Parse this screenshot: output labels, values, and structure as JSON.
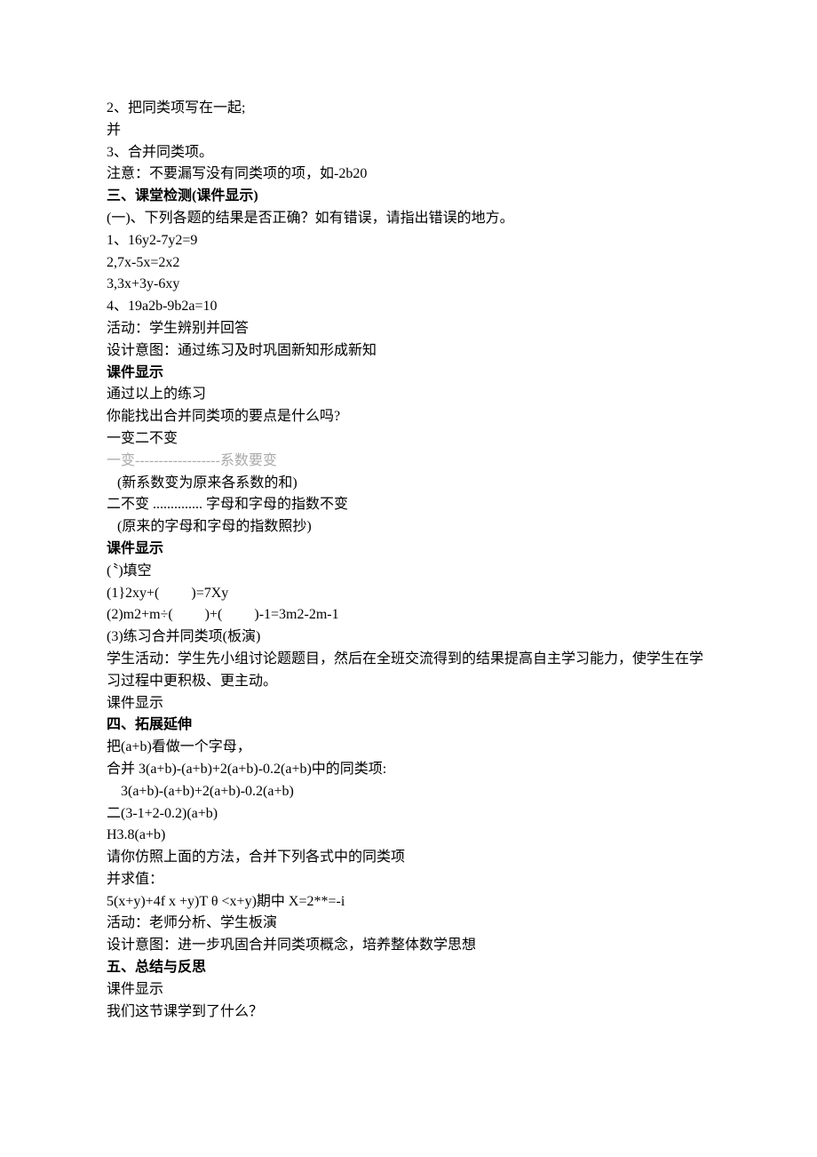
{
  "lines": [
    {
      "t": "2、把同类项写在一起;"
    },
    {
      "t": "并"
    },
    {
      "t": "3、合并同类项。"
    },
    {
      "t": "注意：不要漏写没有同类项的项，如-2b20"
    },
    {
      "t": "三、课堂检测(课件显示)",
      "bold": true
    },
    {
      "t": "(一)、下列各题的结果是否正确？如有错误，请指出错误的地方。"
    },
    {
      "t": "1、16y2-7y2=9"
    },
    {
      "t": "2,7x-5x=2x2"
    },
    {
      "t": "3,3x+3y-6xy"
    },
    {
      "t": "4、19a2b-9b2a=10"
    },
    {
      "t": "活动：学生辨别并回答"
    },
    {
      "t": "设计意图：通过练习及时巩固新知形成新知"
    },
    {
      "t": "课件显示",
      "bold": true
    },
    {
      "t": "通过以上的练习"
    },
    {
      "t": "你能找出合并同类项的要点是什么吗?"
    },
    {
      "t": "一变二不变"
    },
    {
      "t": "一变------------------系数要变",
      "faint": true
    },
    {
      "t": "   (新系数变为原来各系数的和)"
    },
    {
      "t": "二不变 .............. 字母和字母的指数不变"
    },
    {
      "t": "   (原来的字母和字母的指数照抄)"
    },
    {
      "t": "课件显示",
      "bold": true
    },
    {
      "t": "(〝)填空"
    },
    {
      "t": "(1}2xy+(         )=7Xy"
    },
    {
      "t": "(2)m2+m÷(         )+(         )-1=3m2-2m-1"
    },
    {
      "t": "(3)练习合并同类项(板演)"
    },
    {
      "t": "学生活动：学生先小组讨论题题目，然后在全班交流得到的结果提高自主学习能力，使学生在学习过程中更积极、更主动。"
    },
    {
      "t": "课件显示"
    },
    {
      "t": "四、拓展延伸",
      "bold": true
    },
    {
      "t": "把(a+b)看做一个字母，"
    },
    {
      "t": "合并 3(a+b)-(a+b)+2(a+b)-0.2(a+b)中的同类项:"
    },
    {
      "t": "    3(a+b)-(a+b)+2(a+b)-0.2(a+b)"
    },
    {
      "t": "二(3-1+2-0.2)(a+b)"
    },
    {
      "t": "H3.8(a+b)"
    },
    {
      "t": "请你仿照上面的方法，合并下列各式中的同类项"
    },
    {
      "t": "并求值："
    },
    {
      "t": "5(x+y)+4f x +y)T θ <x+y)期中 X=2**=-i"
    },
    {
      "t": "活动：老师分析、学生板演"
    },
    {
      "t": "设计意图：进一步巩固合并同类项概念，培养整体数学思想"
    },
    {
      "t": "五、总结与反思",
      "bold": true
    },
    {
      "t": "课件显示"
    },
    {
      "t": "我们这节课学到了什么？"
    }
  ]
}
